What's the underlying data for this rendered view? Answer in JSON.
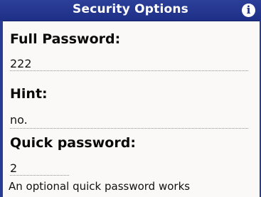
{
  "header": {
    "title": "Security Options",
    "info_icon": "info-icon"
  },
  "fields": {
    "full_password": {
      "label": "Full Password:",
      "value": "222"
    },
    "hint": {
      "label": "Hint:",
      "value": "no."
    },
    "quick_password": {
      "label": "Quick password:",
      "value": "2"
    }
  },
  "footer": {
    "note": "An optional quick password works"
  },
  "colors": {
    "title_bar": "#1e2f86",
    "title_text": "#ffffff",
    "background": "#fbf9f7"
  }
}
